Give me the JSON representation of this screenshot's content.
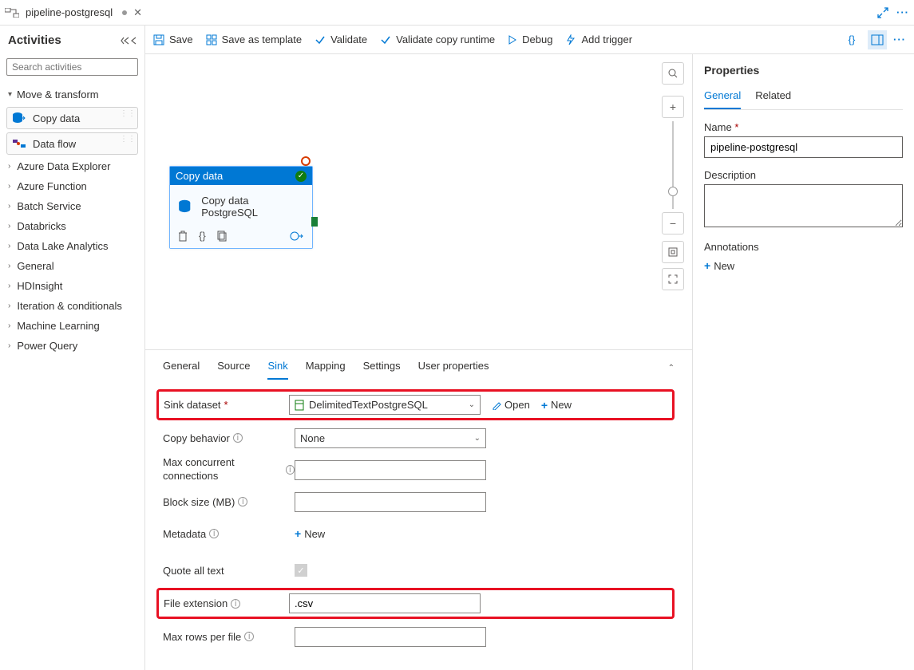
{
  "tab": {
    "title": "pipeline-postgresql"
  },
  "toolbar": {
    "save": "Save",
    "save_template": "Save as template",
    "validate": "Validate",
    "validate_copy": "Validate copy runtime",
    "debug": "Debug",
    "add_trigger": "Add trigger"
  },
  "sidebar": {
    "title": "Activities",
    "search_placeholder": "Search activities",
    "group": "Move & transform",
    "items": [
      {
        "label": "Copy data"
      },
      {
        "label": "Data flow"
      }
    ],
    "categories": [
      "Azure Data Explorer",
      "Azure Function",
      "Batch Service",
      "Databricks",
      "Data Lake Analytics",
      "General",
      "HDInsight",
      "Iteration & conditionals",
      "Machine Learning",
      "Power Query"
    ]
  },
  "node": {
    "head": "Copy data",
    "title": "Copy data PostgreSQL"
  },
  "bottom": {
    "tabs": [
      "General",
      "Source",
      "Sink",
      "Mapping",
      "Settings",
      "User properties"
    ],
    "sink": {
      "dataset_label": "Sink dataset",
      "dataset_value": "DelimitedTextPostgreSQL",
      "open": "Open",
      "new": "New",
      "copy_behavior_label": "Copy behavior",
      "copy_behavior_value": "None",
      "max_conn_label": "Max concurrent connections",
      "block_size_label": "Block size (MB)",
      "metadata_label": "Metadata",
      "metadata_new": "New",
      "quote_label": "Quote all text",
      "file_ext_label": "File extension",
      "file_ext_value": ".csv",
      "max_rows_label": "Max rows per file"
    }
  },
  "properties": {
    "title": "Properties",
    "tabs": [
      "General",
      "Related"
    ],
    "name_label": "Name",
    "name_value": "pipeline-postgresql",
    "desc_label": "Description",
    "anno_label": "Annotations",
    "anno_new": "New"
  }
}
